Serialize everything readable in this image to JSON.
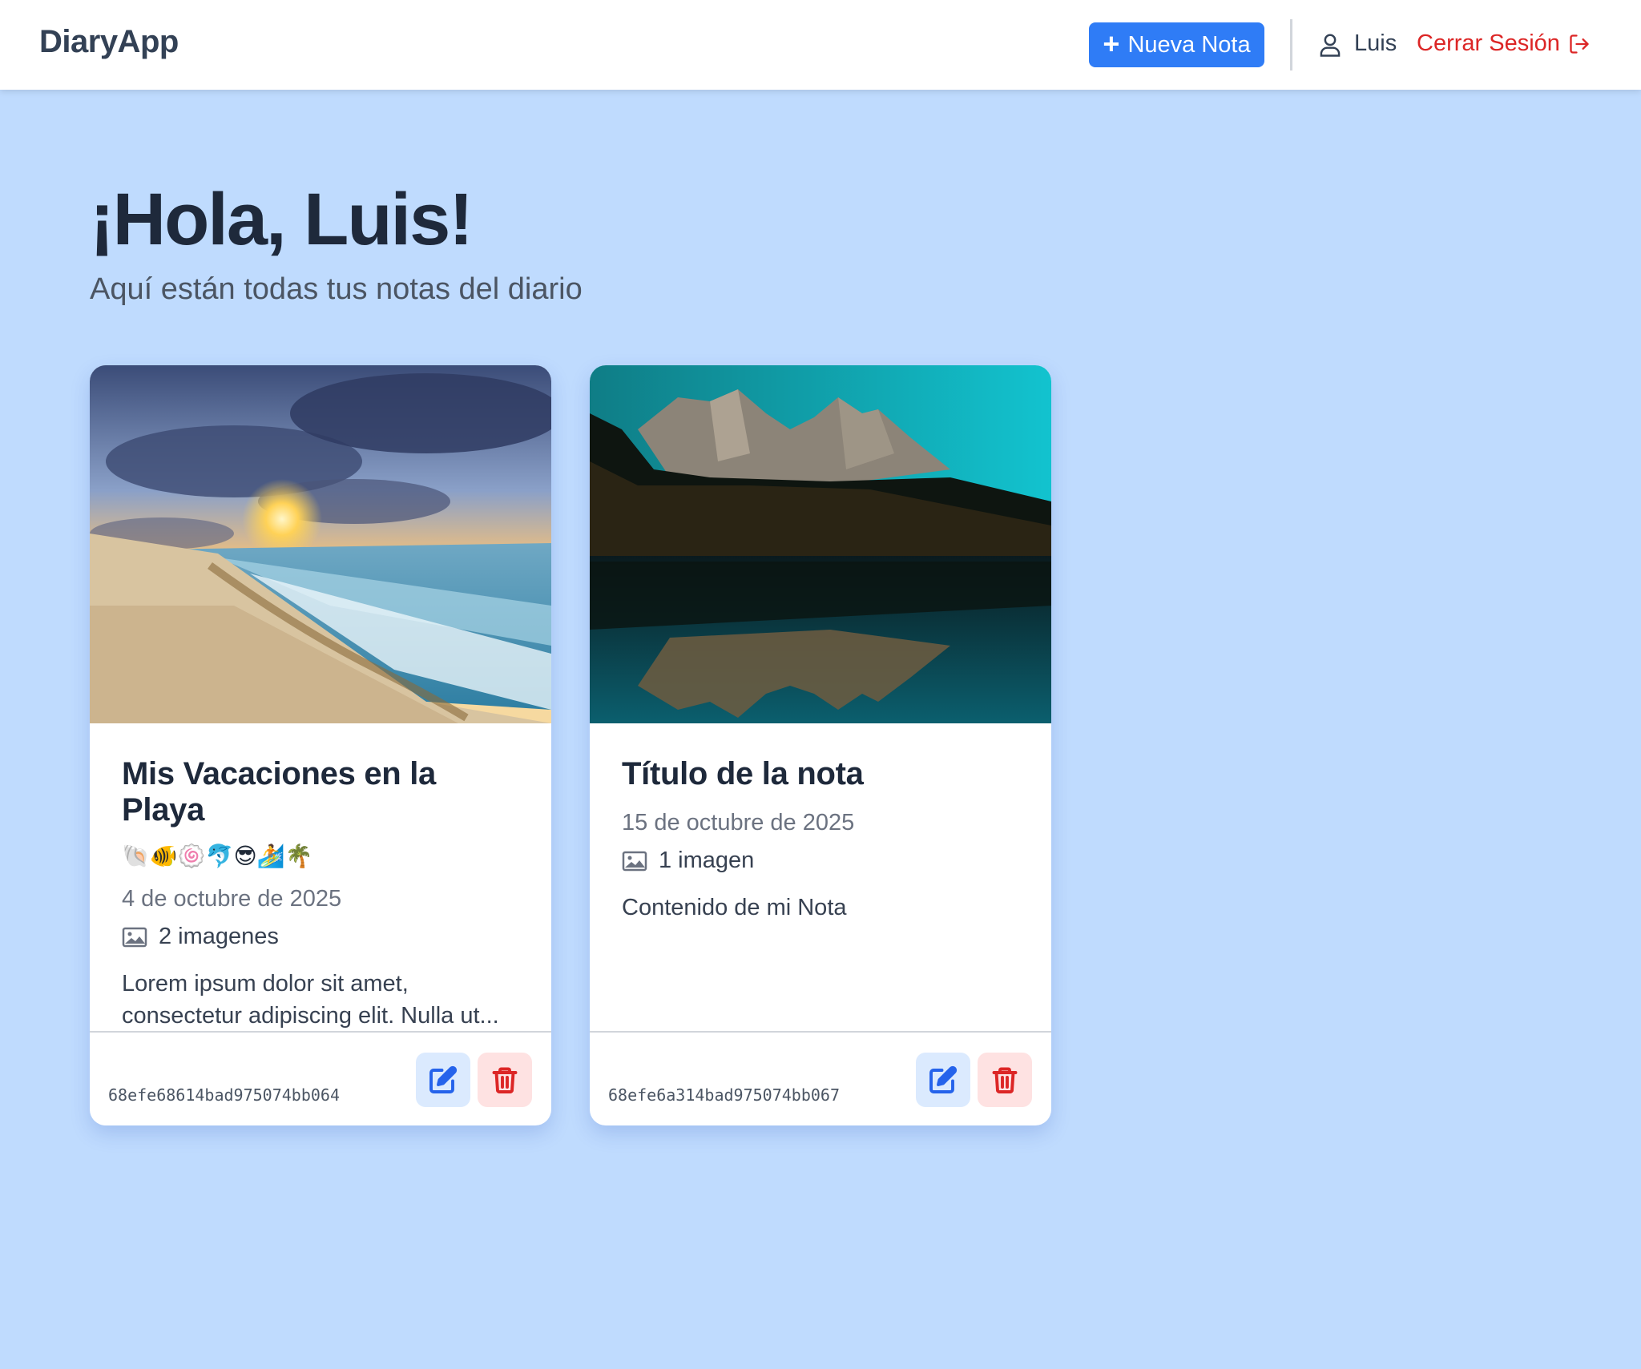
{
  "header": {
    "brand": "DiaryApp",
    "new_note_label": "Nueva Nota",
    "user_name": "Luis",
    "logout_label": "Cerrar Sesión"
  },
  "main": {
    "greeting": "¡Hola, Luis!",
    "subtitle": "Aquí están todas tus notas del diario"
  },
  "notes": [
    {
      "title": "Mis Vacaciones en la Playa",
      "emojis": "🐚🐠🍥🐬😎🏄🌴",
      "date": "4 de octubre de 2025",
      "image_count": "2 imagenes",
      "excerpt": "Lorem ipsum dolor sit amet, consectetur adipiscing elit. Nulla ut...",
      "id": "68efe68614bad975074bb064"
    },
    {
      "title": "Título de la nota",
      "date": "15 de octubre de 2025",
      "image_count": "1 imagen",
      "excerpt": "Contenido de mi Nota",
      "id": "68efe6a314bad975074bb067"
    }
  ],
  "colors": {
    "background": "#bfdbfe",
    "primary": "#2f7cf6",
    "danger": "#dc2626"
  }
}
